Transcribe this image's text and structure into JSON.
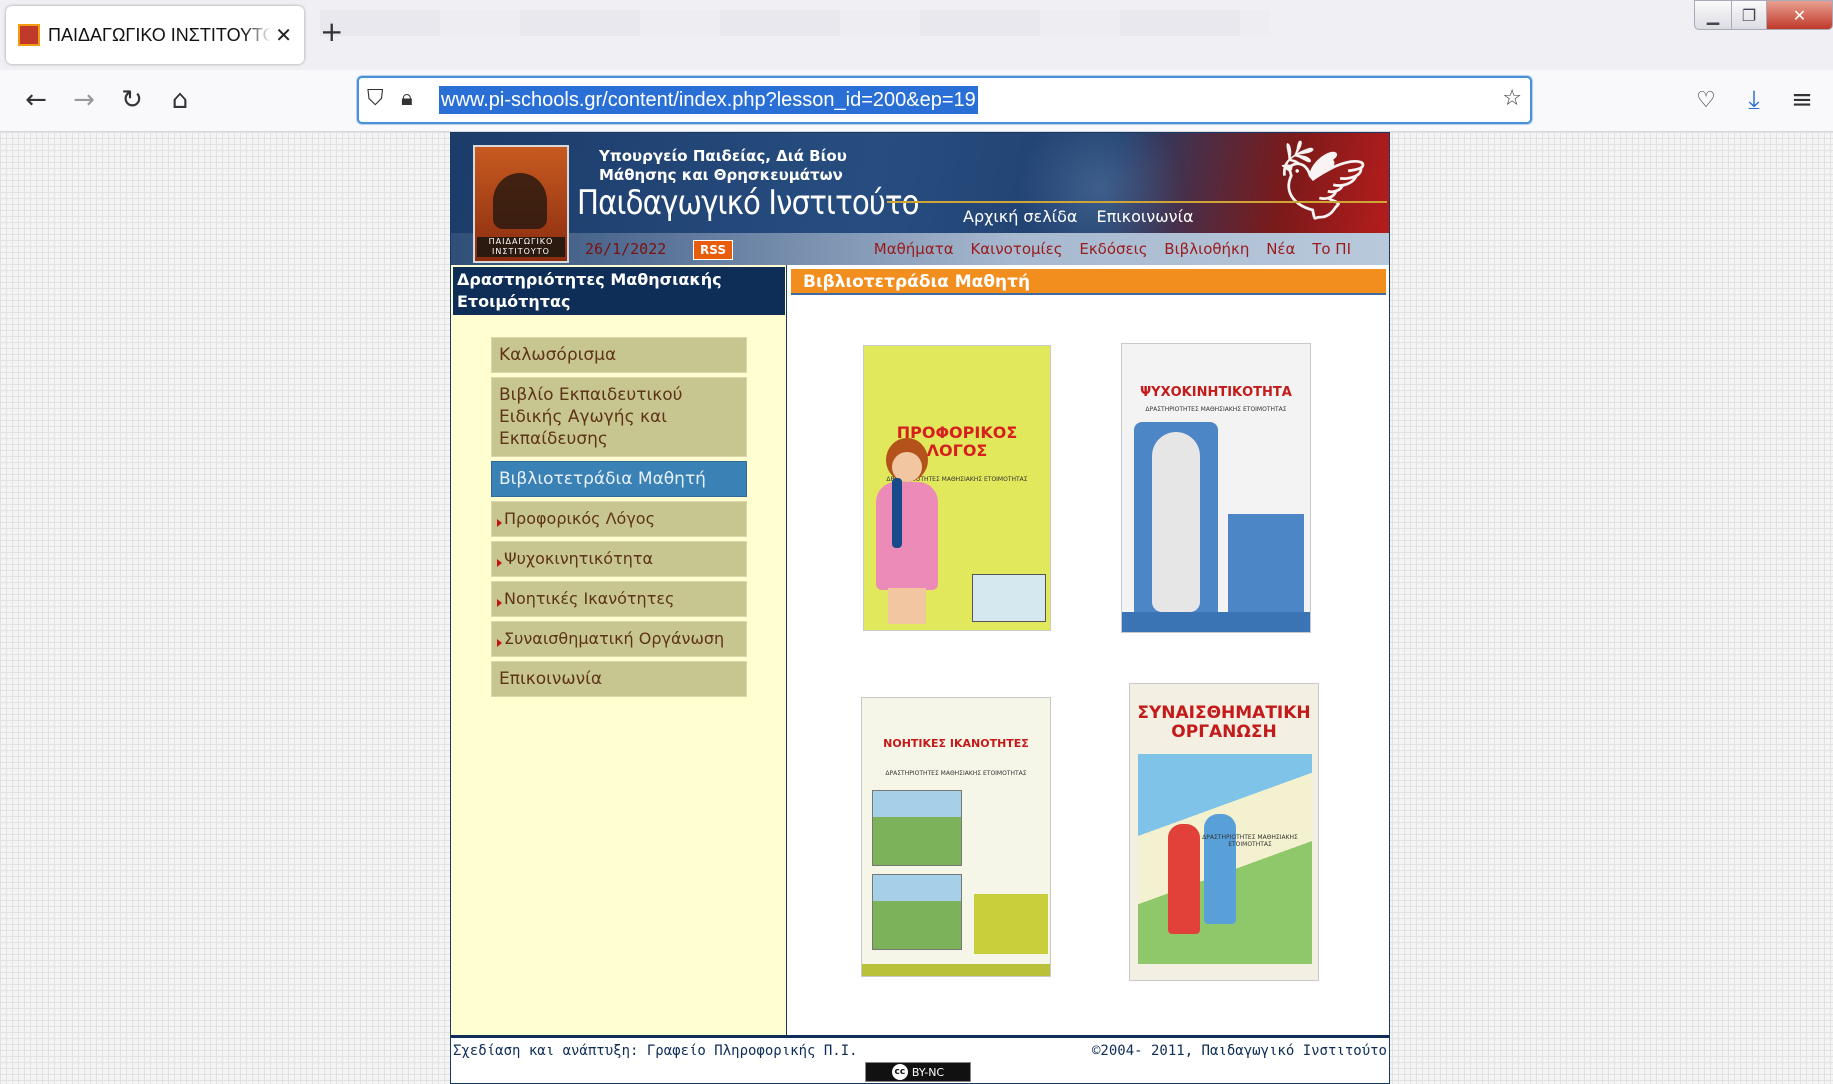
{
  "browser": {
    "tab_title": "ΠΑΙΔΑΓΩΓΙΚΟ ΙΝΣΤΙΤΟΥΤΟ - Δρ",
    "url": "www.pi-schools.gr/content/index.php?lesson_id=200&ep=19",
    "icons": [
      "back-arrow-icon",
      "forward-arrow-icon",
      "reload-icon",
      "home-icon",
      "shield-icon",
      "lock-icon",
      "star-icon",
      "pocket-icon",
      "download-icon",
      "menu-icon"
    ]
  },
  "site": {
    "ministry_line1": "Υπουργείο Παιδείας, Διά Βίου",
    "ministry_line2": "Μάθησης και Θρησκευμάτων",
    "institute": "Παιδαγωγικό Ινστιτούτο",
    "logo_text": "ΠΑΙΔΑΓΩΓΙΚΟ ΙΝΣΤΙΤΟΥΤΟ",
    "top_links": [
      "Αρχική σελίδα",
      "Επικοινωνία"
    ],
    "date": "26/1/2022",
    "rss": "RSS",
    "main_nav": [
      "Μαθήματα",
      "Καινοτομίες",
      "Εκδόσεις",
      "Βιβλιοθήκη",
      "Νέα",
      "Το ΠΙ"
    ]
  },
  "sidebar": {
    "heading": "Δραστηριότητες Μαθησιακής Ετοιμότητας",
    "items": [
      {
        "label": "Καλωσόρισμα"
      },
      {
        "label": "Βιβλίο Εκπαιδευτικού Ειδικής Αγωγής και Εκπαίδευσης"
      },
      {
        "label": "Βιβλιοτετράδια Μαθητή"
      },
      {
        "label": "Προφορικός Λόγος"
      },
      {
        "label": "Ψυχοκινητικότητα"
      },
      {
        "label": "Νοητικές Ικανότητες"
      },
      {
        "label": "Συναισθηματική Οργάνωση"
      },
      {
        "label": "Επικοινωνία"
      }
    ],
    "active_index": 2
  },
  "main": {
    "heading": "Βιβλιοτετράδια Μαθητή",
    "books": [
      {
        "title": "ΠΡΟΦΟΡΙΚΟΣ ΛΟΓΟΣ",
        "subtitle": "ΔΡΑΣΤΗΡΙΟΤΗΤΕΣ ΜΑΘΗΣΙΑΚΗΣ ΕΤΟΙΜΟΤΗΤΑΣ"
      },
      {
        "title": "ΨΥΧΟΚΙΝΗΤΙΚΟΤΗΤΑ",
        "subtitle": "ΔΡΑΣΤΗΡΙΟΤΗΤΕΣ ΜΑΘΗΣΙΑΚΗΣ ΕΤΟΙΜΟΤΗΤΑΣ"
      },
      {
        "title": "ΝΟΗΤΙΚΕΣ ΙΚΑΝΟΤΗΤΕΣ",
        "subtitle": "ΔΡΑΣΤΗΡΙΟΤΗΤΕΣ ΜΑΘΗΣΙΑΚΗΣ ΕΤΟΙΜΟΤΗΤΑΣ"
      },
      {
        "title": "ΣΥΝΑΙΣΘΗΜΑΤΙΚΗ ΟΡΓΑΝΩΣΗ",
        "subtitle": "ΔΡΑΣΤΗΡΙΟΤΗΤΕΣ ΜΑΘΗΣΙΑΚΗΣ ΕΤΟΙΜΟΤΗΤΑΣ"
      }
    ]
  },
  "footer": {
    "credits": "Σχεδίαση και ανάπτυξη: Γραφείο Πληροφορικής Π.Ι.",
    "copyright": "©2004- 2011, Παιδαγωγικό Ινστιτούτο",
    "license_mark": "cc",
    "license": "BY-NC"
  },
  "colors": {
    "banner_blue": "#1c3c6a",
    "banner_red": "#b51c1c",
    "sidebar_bg": "#fffed0",
    "menu_bg": "#c7c690",
    "menu_active": "#3a81b6",
    "heading_orange": "#f18e1d"
  }
}
